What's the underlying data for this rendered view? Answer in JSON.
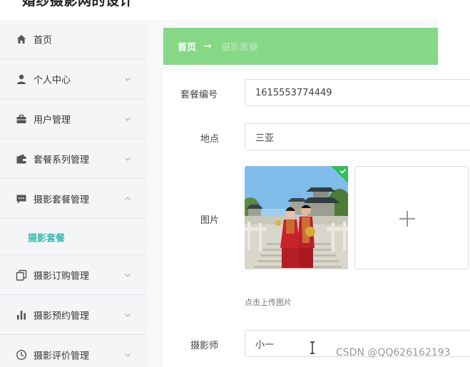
{
  "app": {
    "title": "婚纱摄影网的设计"
  },
  "sidebar": {
    "items": [
      {
        "label": "首页",
        "icon": "home-icon"
      },
      {
        "label": "个人中心",
        "icon": "user-icon"
      },
      {
        "label": "用户管理",
        "icon": "briefcase-icon"
      },
      {
        "label": "套餐系列管理",
        "icon": "wallet-icon"
      },
      {
        "label": "摄影套餐管理",
        "icon": "chat-icon"
      },
      {
        "label": "摄影订购管理",
        "icon": "copy-icon"
      },
      {
        "label": "摄影预约管理",
        "icon": "bar-chart-icon"
      },
      {
        "label": "摄影评价管理",
        "icon": "clock-icon"
      }
    ],
    "submenu": {
      "label": "摄影套餐"
    }
  },
  "breadcrumb": {
    "home": "首页",
    "separator": "→",
    "current": "摄影套餐"
  },
  "form": {
    "package_no": {
      "label": "套餐编号",
      "value": "1615553774449"
    },
    "location": {
      "label": "地点",
      "value": "三亚"
    },
    "image": {
      "label": "图片",
      "upload_hint": "点击上传图片",
      "plus_icon": "plus-icon"
    },
    "photographer": {
      "label": "摄影师",
      "value": "小一"
    }
  },
  "watermark": "CSDN @QQ626162193",
  "colors": {
    "sidebar_bg": "#f4f5f7",
    "accent_teal": "#3cb9b2",
    "breadcrumb_bg": "#86d886",
    "success_green": "#2fbf5e"
  }
}
